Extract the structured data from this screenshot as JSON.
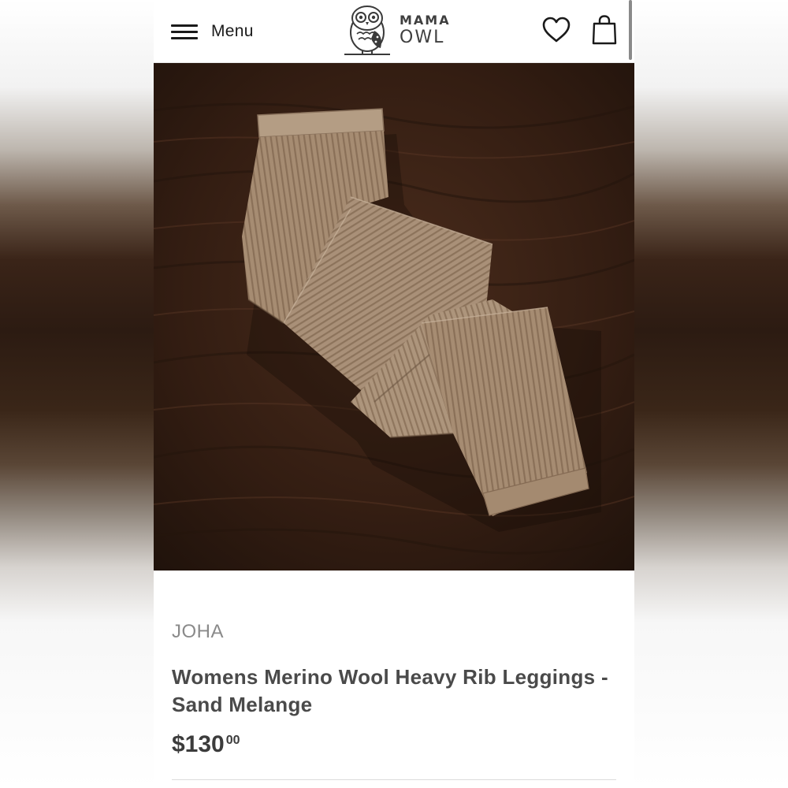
{
  "header": {
    "menu_label": "Menu",
    "logo": {
      "line1": "MAMA",
      "line2": "OWL"
    },
    "icons": {
      "menu": "hamburger-menu-icon",
      "wishlist": "heart-icon",
      "cart": "shopping-bag-icon"
    }
  },
  "product": {
    "image_alt": "Ribbed sand-colored merino wool leggings folded on a dark wooden surface",
    "brand": "JOHA",
    "title": "Womens Merino Wool Heavy Rib Leggings - Sand Melange",
    "price_main": "$130",
    "price_cents": "00"
  },
  "colors": {
    "text_dark": "#4a4a4a",
    "brand_gray": "#8a8a8a",
    "wood": "#3a2216",
    "fabric": "#a48a70"
  }
}
